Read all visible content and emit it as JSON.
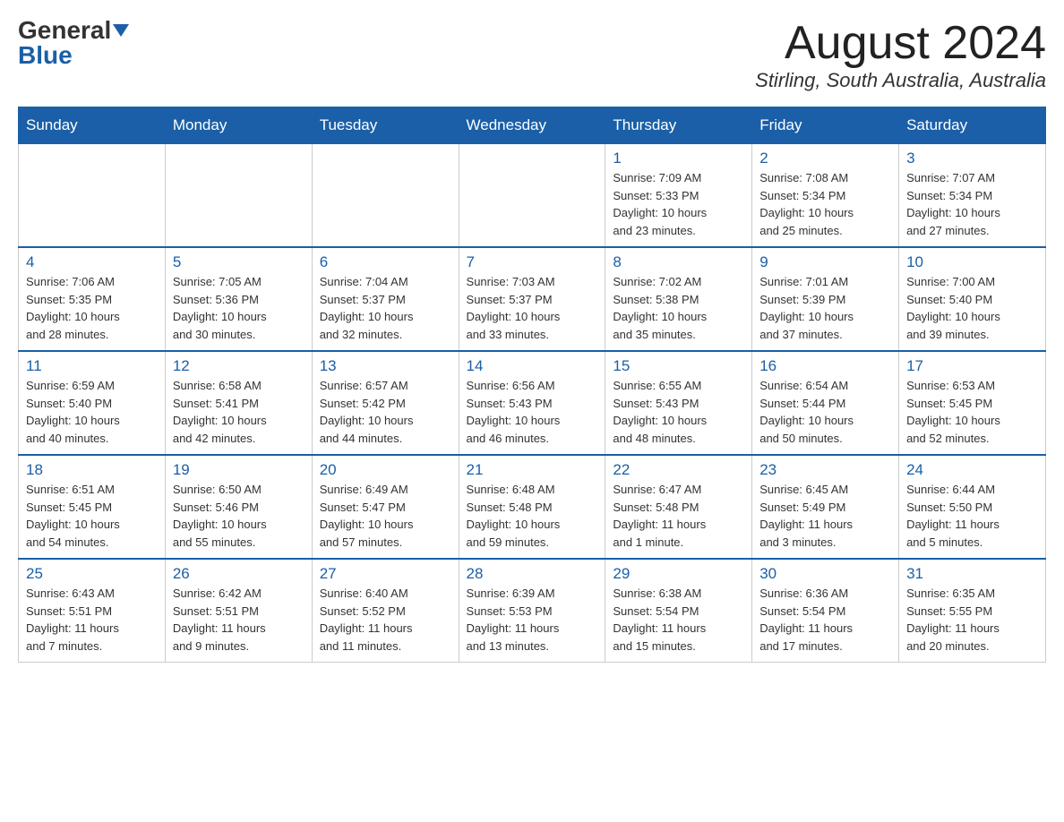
{
  "header": {
    "logo_general": "General",
    "logo_blue": "Blue",
    "month_title": "August 2024",
    "location": "Stirling, South Australia, Australia"
  },
  "days_of_week": [
    "Sunday",
    "Monday",
    "Tuesday",
    "Wednesday",
    "Thursday",
    "Friday",
    "Saturday"
  ],
  "weeks": [
    [
      {
        "day": "",
        "info": ""
      },
      {
        "day": "",
        "info": ""
      },
      {
        "day": "",
        "info": ""
      },
      {
        "day": "",
        "info": ""
      },
      {
        "day": "1",
        "info": "Sunrise: 7:09 AM\nSunset: 5:33 PM\nDaylight: 10 hours\nand 23 minutes."
      },
      {
        "day": "2",
        "info": "Sunrise: 7:08 AM\nSunset: 5:34 PM\nDaylight: 10 hours\nand 25 minutes."
      },
      {
        "day": "3",
        "info": "Sunrise: 7:07 AM\nSunset: 5:34 PM\nDaylight: 10 hours\nand 27 minutes."
      }
    ],
    [
      {
        "day": "4",
        "info": "Sunrise: 7:06 AM\nSunset: 5:35 PM\nDaylight: 10 hours\nand 28 minutes."
      },
      {
        "day": "5",
        "info": "Sunrise: 7:05 AM\nSunset: 5:36 PM\nDaylight: 10 hours\nand 30 minutes."
      },
      {
        "day": "6",
        "info": "Sunrise: 7:04 AM\nSunset: 5:37 PM\nDaylight: 10 hours\nand 32 minutes."
      },
      {
        "day": "7",
        "info": "Sunrise: 7:03 AM\nSunset: 5:37 PM\nDaylight: 10 hours\nand 33 minutes."
      },
      {
        "day": "8",
        "info": "Sunrise: 7:02 AM\nSunset: 5:38 PM\nDaylight: 10 hours\nand 35 minutes."
      },
      {
        "day": "9",
        "info": "Sunrise: 7:01 AM\nSunset: 5:39 PM\nDaylight: 10 hours\nand 37 minutes."
      },
      {
        "day": "10",
        "info": "Sunrise: 7:00 AM\nSunset: 5:40 PM\nDaylight: 10 hours\nand 39 minutes."
      }
    ],
    [
      {
        "day": "11",
        "info": "Sunrise: 6:59 AM\nSunset: 5:40 PM\nDaylight: 10 hours\nand 40 minutes."
      },
      {
        "day": "12",
        "info": "Sunrise: 6:58 AM\nSunset: 5:41 PM\nDaylight: 10 hours\nand 42 minutes."
      },
      {
        "day": "13",
        "info": "Sunrise: 6:57 AM\nSunset: 5:42 PM\nDaylight: 10 hours\nand 44 minutes."
      },
      {
        "day": "14",
        "info": "Sunrise: 6:56 AM\nSunset: 5:43 PM\nDaylight: 10 hours\nand 46 minutes."
      },
      {
        "day": "15",
        "info": "Sunrise: 6:55 AM\nSunset: 5:43 PM\nDaylight: 10 hours\nand 48 minutes."
      },
      {
        "day": "16",
        "info": "Sunrise: 6:54 AM\nSunset: 5:44 PM\nDaylight: 10 hours\nand 50 minutes."
      },
      {
        "day": "17",
        "info": "Sunrise: 6:53 AM\nSunset: 5:45 PM\nDaylight: 10 hours\nand 52 minutes."
      }
    ],
    [
      {
        "day": "18",
        "info": "Sunrise: 6:51 AM\nSunset: 5:45 PM\nDaylight: 10 hours\nand 54 minutes."
      },
      {
        "day": "19",
        "info": "Sunrise: 6:50 AM\nSunset: 5:46 PM\nDaylight: 10 hours\nand 55 minutes."
      },
      {
        "day": "20",
        "info": "Sunrise: 6:49 AM\nSunset: 5:47 PM\nDaylight: 10 hours\nand 57 minutes."
      },
      {
        "day": "21",
        "info": "Sunrise: 6:48 AM\nSunset: 5:48 PM\nDaylight: 10 hours\nand 59 minutes."
      },
      {
        "day": "22",
        "info": "Sunrise: 6:47 AM\nSunset: 5:48 PM\nDaylight: 11 hours\nand 1 minute."
      },
      {
        "day": "23",
        "info": "Sunrise: 6:45 AM\nSunset: 5:49 PM\nDaylight: 11 hours\nand 3 minutes."
      },
      {
        "day": "24",
        "info": "Sunrise: 6:44 AM\nSunset: 5:50 PM\nDaylight: 11 hours\nand 5 minutes."
      }
    ],
    [
      {
        "day": "25",
        "info": "Sunrise: 6:43 AM\nSunset: 5:51 PM\nDaylight: 11 hours\nand 7 minutes."
      },
      {
        "day": "26",
        "info": "Sunrise: 6:42 AM\nSunset: 5:51 PM\nDaylight: 11 hours\nand 9 minutes."
      },
      {
        "day": "27",
        "info": "Sunrise: 6:40 AM\nSunset: 5:52 PM\nDaylight: 11 hours\nand 11 minutes."
      },
      {
        "day": "28",
        "info": "Sunrise: 6:39 AM\nSunset: 5:53 PM\nDaylight: 11 hours\nand 13 minutes."
      },
      {
        "day": "29",
        "info": "Sunrise: 6:38 AM\nSunset: 5:54 PM\nDaylight: 11 hours\nand 15 minutes."
      },
      {
        "day": "30",
        "info": "Sunrise: 6:36 AM\nSunset: 5:54 PM\nDaylight: 11 hours\nand 17 minutes."
      },
      {
        "day": "31",
        "info": "Sunrise: 6:35 AM\nSunset: 5:55 PM\nDaylight: 11 hours\nand 20 minutes."
      }
    ]
  ]
}
